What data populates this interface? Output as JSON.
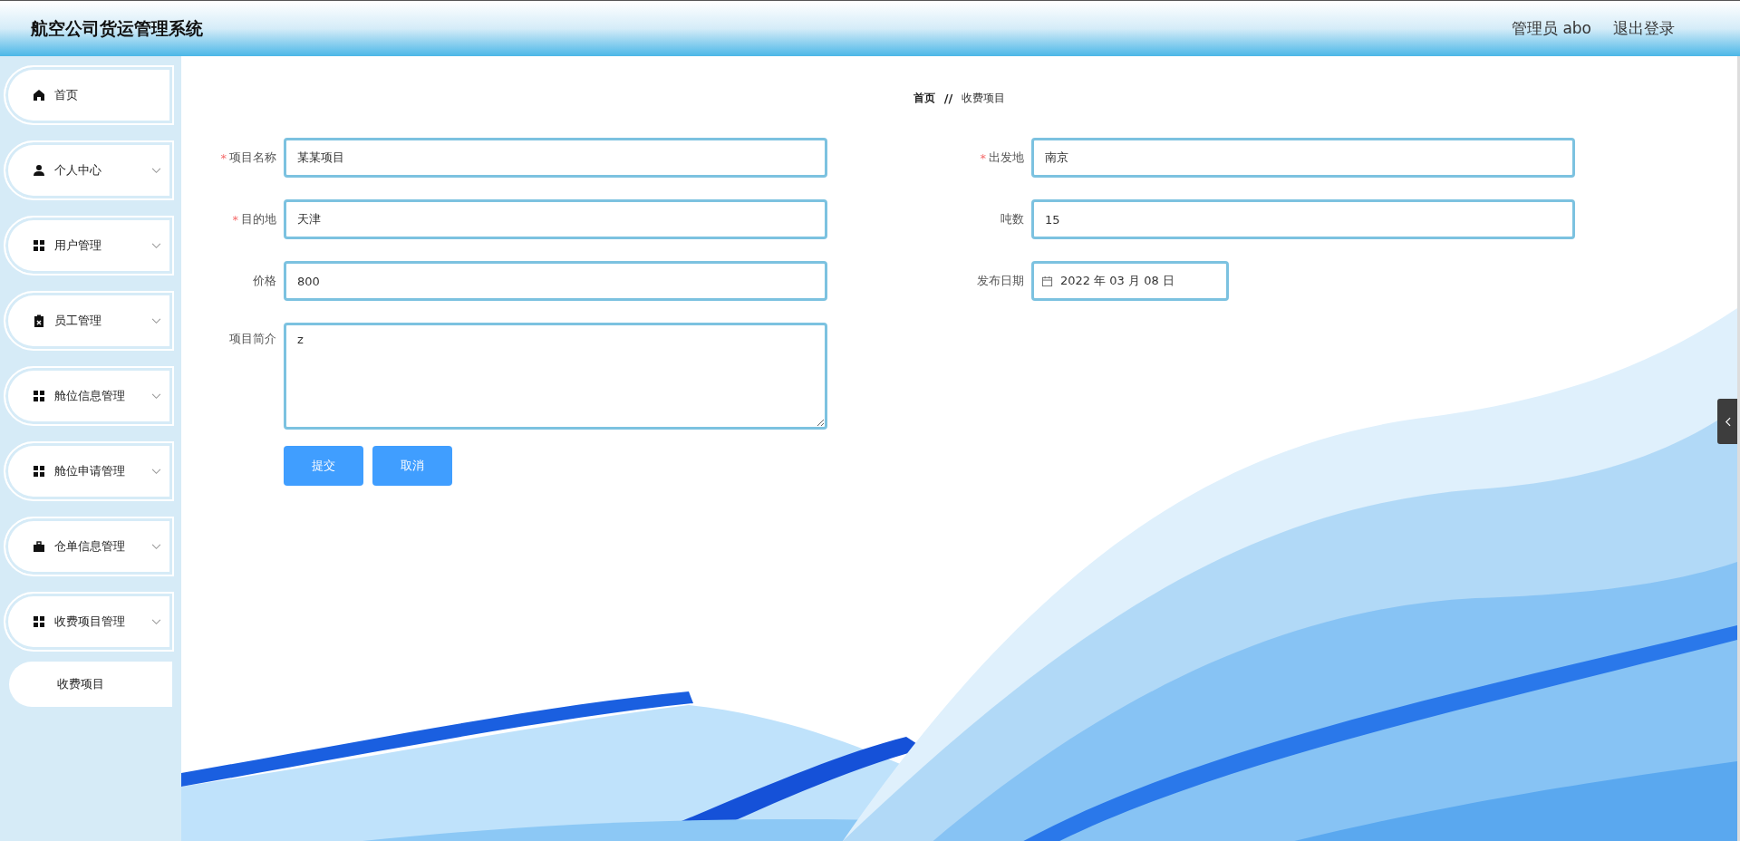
{
  "header": {
    "title": "航空公司货运管理系统",
    "user": "管理员 abo",
    "logout": "退出登录"
  },
  "sidebar": {
    "items": [
      {
        "label": "首页",
        "kind": "home",
        "expandable": false
      },
      {
        "label": "个人中心",
        "kind": "user",
        "expandable": true
      },
      {
        "label": "用户管理",
        "kind": "grid",
        "expandable": true
      },
      {
        "label": "员工管理",
        "kind": "clipboard",
        "expandable": true
      },
      {
        "label": "舱位信息管理",
        "kind": "grid",
        "expandable": true
      },
      {
        "label": "舱位申请管理",
        "kind": "grid",
        "expandable": true
      },
      {
        "label": "仓单信息管理",
        "kind": "briefcase",
        "expandable": true
      },
      {
        "label": "收费项目管理",
        "kind": "grid",
        "expandable": true,
        "children": [
          {
            "label": "收费项目"
          }
        ]
      }
    ]
  },
  "breadcrumb": {
    "items": [
      "首页",
      "收费项目"
    ],
    "separator": "//"
  },
  "form": {
    "required_mark": "*",
    "fields": [
      {
        "label": "项目名称",
        "required": true,
        "kind": "text",
        "value": "某某项目"
      },
      {
        "label": "出发地",
        "required": true,
        "kind": "text",
        "value": "南京"
      },
      {
        "label": "目的地",
        "required": true,
        "kind": "text",
        "value": "天津"
      },
      {
        "label": "吨数",
        "required": false,
        "kind": "text",
        "value": "15"
      },
      {
        "label": "价格",
        "required": false,
        "kind": "text",
        "value": "800"
      },
      {
        "label": "发布日期",
        "required": false,
        "kind": "date",
        "value": "2022 年 03 月 08 日"
      },
      {
        "label": "项目简介",
        "required": false,
        "kind": "textarea",
        "value": "z"
      }
    ],
    "buttons": [
      "提交",
      "取消"
    ]
  }
}
